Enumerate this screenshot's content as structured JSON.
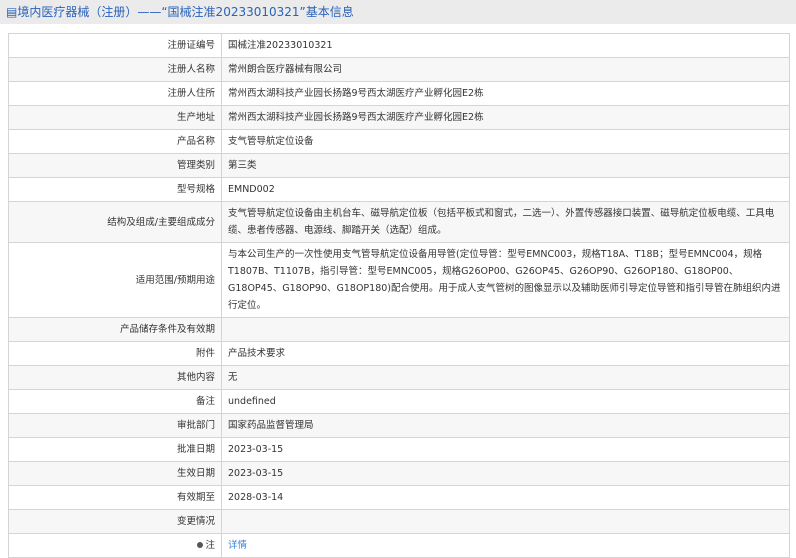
{
  "header": {
    "title": "境内医疗器械（注册）——“国械注准20233010321”基本信息"
  },
  "rows": [
    {
      "label": "注册证编号",
      "value": "国械注准20233010321"
    },
    {
      "label": "注册人名称",
      "value": "常州朗合医疗器械有限公司"
    },
    {
      "label": "注册人住所",
      "value": "常州西太湖科技产业园长扬路9号西太湖医疗产业孵化园E2栋"
    },
    {
      "label": "生产地址",
      "value": "常州西太湖科技产业园长扬路9号西太湖医疗产业孵化园E2栋"
    },
    {
      "label": "产品名称",
      "value": "支气管导航定位设备"
    },
    {
      "label": "管理类别",
      "value": "第三类"
    },
    {
      "label": "型号规格",
      "value": "EMND002"
    },
    {
      "label": "结构及组成/主要组成成分",
      "value": "支气管导航定位设备由主机台车、磁导航定位板（包括平板式和窗式，二选一）、外置传感器接口装置、磁导航定位板电缆、工具电缆、患者传感器、电源线、脚踏开关（选配）组成。"
    },
    {
      "label": "适用范围/预期用途",
      "value": "与本公司生产的一次性使用支气管导航定位设备用导管(定位导管：型号EMNC003，规格T18A、T18B；型号EMNC004，规格T1807B、T1107B，指引导管：型号EMNC005，规格G26OP00、G26OP45、G26OP90、G26OP180、G18OP00、G18OP45、G18OP90、G18OP180)配合使用。用于成人支气管树的图像显示以及辅助医师引导定位导管和指引导管在肺组织内进行定位。"
    },
    {
      "label": "产品储存条件及有效期",
      "value": ""
    },
    {
      "label": "附件",
      "value": "产品技术要求"
    },
    {
      "label": "其他内容",
      "value": "无"
    },
    {
      "label": "备注",
      "value": "undefined"
    },
    {
      "label": "审批部门",
      "value": "国家药品监督管理局"
    },
    {
      "label": "批准日期",
      "value": "2023-03-15"
    },
    {
      "label": "生效日期",
      "value": "2023-03-15"
    },
    {
      "label": "有效期至",
      "value": "2028-03-14"
    },
    {
      "label": "变更情况",
      "value": ""
    }
  ],
  "note": {
    "label": "注",
    "link": "详情"
  }
}
